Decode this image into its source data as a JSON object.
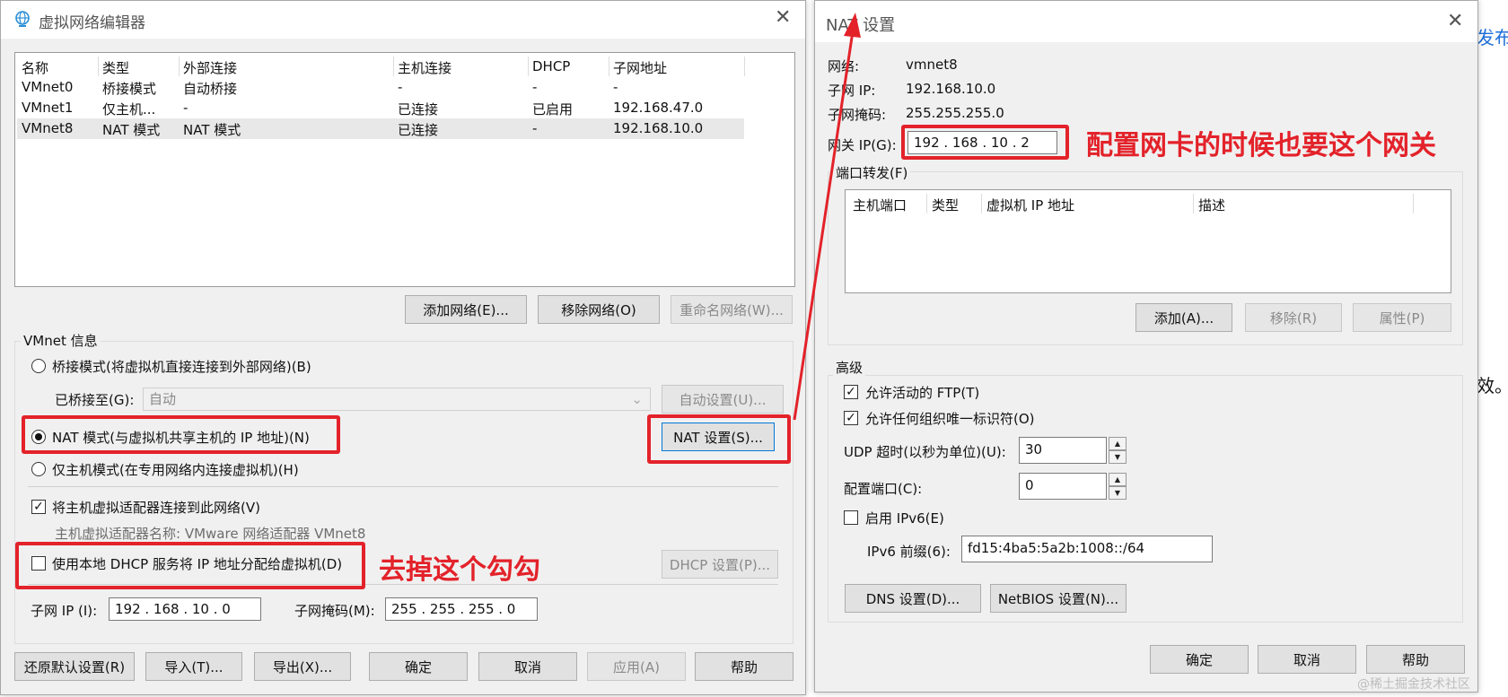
{
  "vne": {
    "title": "虚拟网络编辑器",
    "columns": [
      "名称",
      "类型",
      "外部连接",
      "主机连接",
      "DHCP",
      "子网地址"
    ],
    "rows": [
      [
        "VMnet0",
        "桥接模式",
        "自动桥接",
        "-",
        "-",
        "-"
      ],
      [
        "VMnet1",
        "仅主机...",
        "-",
        "已连接",
        "已启用",
        "192.168.47.0"
      ],
      [
        "VMnet8",
        "NAT 模式",
        "NAT 模式",
        "已连接",
        "-",
        "192.168.10.0"
      ]
    ],
    "btn_add": "添加网络(E)...",
    "btn_remove": "移除网络(O)",
    "btn_rename": "重命名网络(W)...",
    "info_title": "VMnet 信息",
    "radio_bridge": "桥接模式(将虚拟机直接连接到外部网络)(B)",
    "bridged_to_label": "已桥接至(G):",
    "bridged_to_value": "自动",
    "btn_auto": "自动设置(U)...",
    "radio_nat": "NAT 模式(与虚拟机共享主机的 IP 地址)(N)",
    "btn_nat": "NAT 设置(S)...",
    "radio_host": "仅主机模式(在专用网络内连接虚拟机)(H)",
    "chk_adapter": "将主机虚拟适配器连接到此网络(V)",
    "adapter_name": "主机虚拟适配器名称: VMware 网络适配器 VMnet8",
    "chk_dhcp": "使用本地 DHCP 服务将 IP 地址分配给虚拟机(D)",
    "btn_dhcp": "DHCP 设置(P)...",
    "subnet_ip_label": "子网 IP (I):",
    "subnet_ip_value": "192 . 168 . 10 . 0",
    "subnet_mask_label": "子网掩码(M):",
    "subnet_mask_value": "255 . 255 . 255 . 0",
    "btn_restore": "还原默认设置(R)",
    "btn_import": "导入(T)...",
    "btn_export": "导出(X)...",
    "btn_ok": "确定",
    "btn_cancel": "取消",
    "btn_apply": "应用(A)",
    "btn_help": "帮助"
  },
  "nat": {
    "title": "NAT 设置",
    "network_label": "网络:",
    "network_value": "vmnet8",
    "subnet_ip_label": "子网 IP:",
    "subnet_ip_value": "192.168.10.0",
    "subnet_mask_label": "子网掩码:",
    "subnet_mask_value": "255.255.255.0",
    "gateway_label": "网关 IP(G):",
    "gateway_value": "192 . 168 . 10 . 2",
    "pf_title": "端口转发(F)",
    "pf_columns": [
      "主机端口",
      "类型",
      "虚拟机 IP 地址",
      "描述"
    ],
    "btn_add": "添加(A)...",
    "btn_remove": "移除(R)",
    "btn_props": "属性(P)",
    "adv_title": "高级",
    "chk_ftp": "允许活动的 FTP(T)",
    "chk_oui": "允许任何组织唯一标识符(O)",
    "udp_label": "UDP 超时(以秒为单位)(U):",
    "udp_value": "30",
    "config_port_label": "配置端口(C):",
    "config_port_value": "0",
    "chk_ipv6": "启用 IPv6(E)",
    "ipv6_prefix_label": "IPv6 前缀(6):",
    "ipv6_prefix_value": "fd15:4ba5:5a2b:1008::/64",
    "btn_dns": "DNS 设置(D)...",
    "btn_netbios": "NetBIOS 设置(N)...",
    "btn_ok": "确定",
    "btn_cancel": "取消",
    "btn_help": "帮助"
  },
  "annotations": {
    "gateway_note": "配置网卡的时候也要这个网关",
    "dhcp_note": "去掉这个勾勾",
    "color": "#e3222a"
  },
  "background": {
    "text_top": "发布",
    "text_mid": "效。"
  },
  "watermark": "@稀土掘金技术社区"
}
